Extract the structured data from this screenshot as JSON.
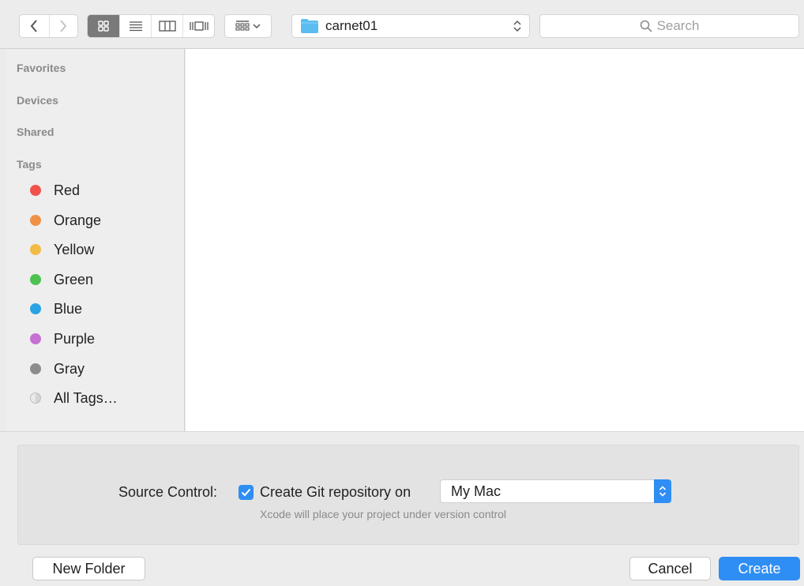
{
  "toolbar": {
    "path": "carnet01",
    "search_placeholder": "Search"
  },
  "sidebar": {
    "sections": [
      {
        "label": "Favorites"
      },
      {
        "label": "Devices"
      },
      {
        "label": "Shared"
      },
      {
        "label": "Tags"
      }
    ],
    "tags": [
      {
        "label": "Red",
        "color": "#f0534a"
      },
      {
        "label": "Orange",
        "color": "#f19146"
      },
      {
        "label": "Yellow",
        "color": "#f2bb45"
      },
      {
        "label": "Green",
        "color": "#4cc350"
      },
      {
        "label": "Blue",
        "color": "#2aa2e3"
      },
      {
        "label": "Purple",
        "color": "#c571d3"
      },
      {
        "label": "Gray",
        "color": "#8c8c8c"
      },
      {
        "label": "All Tags…",
        "color": "#d8d8d8"
      }
    ]
  },
  "options": {
    "source_control_label": "Source Control:",
    "checkbox_label": "Create Git repository on",
    "checkbox_checked": true,
    "location_value": "My Mac",
    "hint": "Xcode will place your project under version control"
  },
  "buttons": {
    "new_folder": "New Folder",
    "cancel": "Cancel",
    "create": "Create"
  },
  "colors": {
    "accent": "#2f8ef3",
    "folder": "#5bbcf0"
  }
}
